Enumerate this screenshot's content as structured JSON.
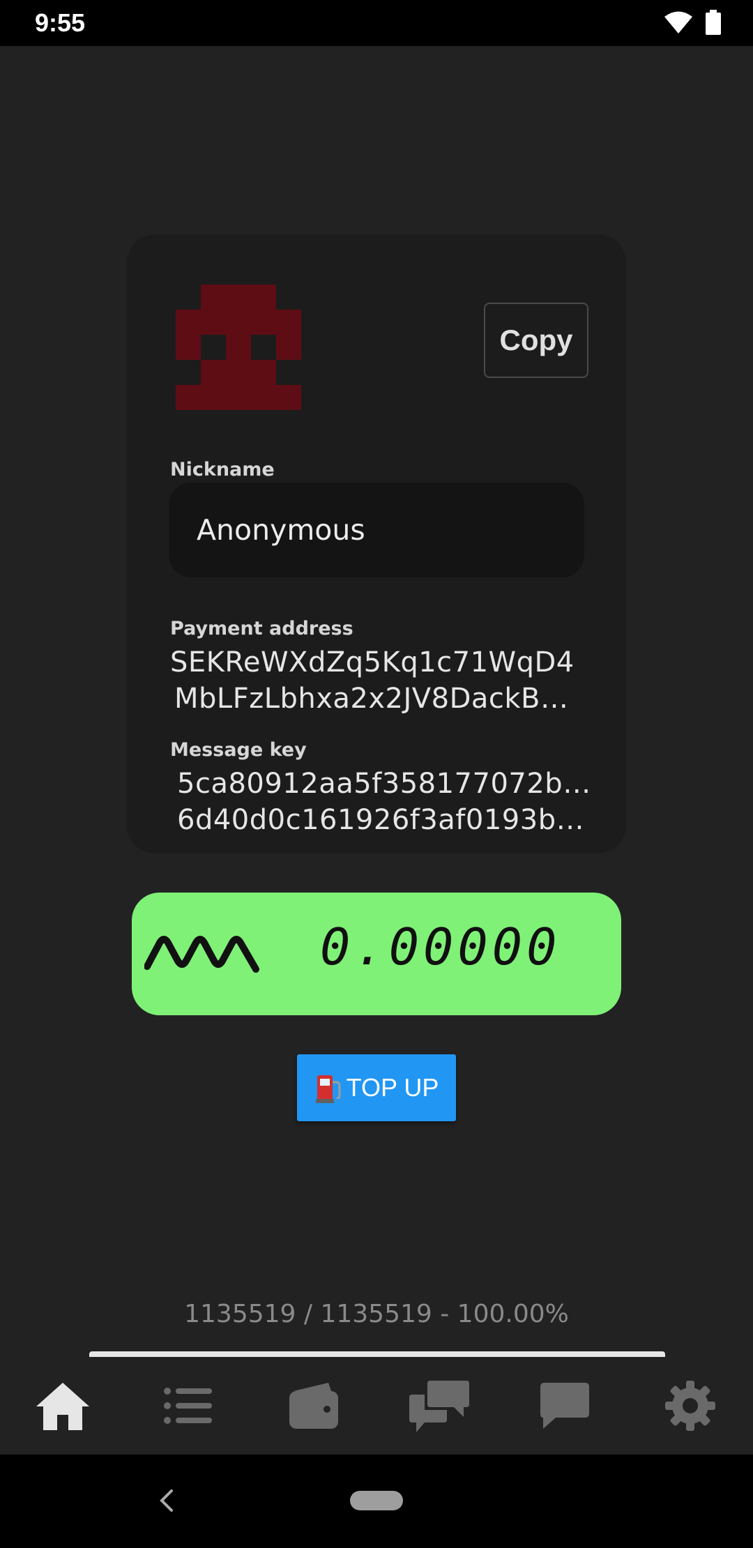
{
  "status_bar": {
    "time": "9:55"
  },
  "card": {
    "copy_label": "Copy",
    "nickname_label": "Nickname",
    "nickname_value": "Anonymous",
    "payment_address_label": "Payment address",
    "payment_address_line1": "SEKReWXdZq5Kq1c71WqD4",
    "payment_address_line2": "MbLFzLbhxa2x2JV8DackB…",
    "message_key_label": "Message key",
    "message_key_line1": "5ca80912aa5f358177072b2c",
    "message_key_line2": "6d40d0c161926f3af0193b5…",
    "avatar_color": "#5e0d15"
  },
  "balance": {
    "value": "0.00000",
    "background": "#7ff177"
  },
  "top_up": {
    "label": "TOP UP",
    "icon": "fuel-pump-icon",
    "color": "#2196f3"
  },
  "sync": {
    "text": "1135519 / 1135519 - 100.00%"
  },
  "bottom_nav": {
    "items": [
      {
        "icon": "home-icon",
        "active": true
      },
      {
        "icon": "list-icon",
        "active": false
      },
      {
        "icon": "wallet-icon",
        "active": false
      },
      {
        "icon": "chats-icon",
        "active": false
      },
      {
        "icon": "message-icon",
        "active": false
      },
      {
        "icon": "settings-icon",
        "active": false
      }
    ]
  }
}
